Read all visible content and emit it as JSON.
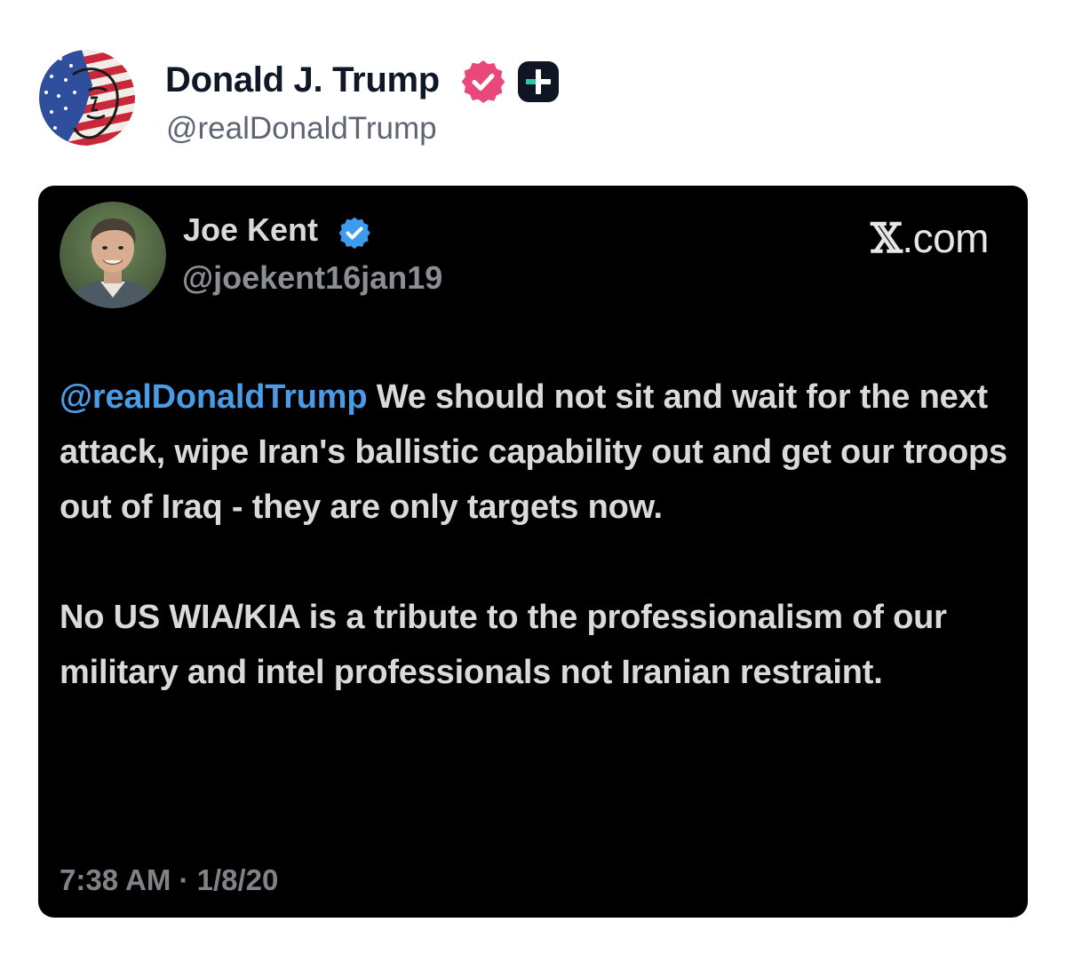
{
  "post": {
    "author_name": "Donald J. Trump",
    "author_handle": "@realDonaldTrump",
    "avatar_icon": "flag-portrait-avatar",
    "verified_icon": "verified-badge-icon",
    "plus_icon": "plus-badge-icon",
    "colors": {
      "name": "#101828",
      "handle": "#5f6673",
      "verified": "#e8497a",
      "plus_bg": "#0f1522",
      "plus_accent": "#29c7a3"
    }
  },
  "embed": {
    "author_name": "Joe Kent",
    "author_handle": "@joekent16jan19",
    "source_x": "𝕏",
    "source_domain": ".com",
    "mention": "@realDonaldTrump",
    "paragraph1_rest": " We should not sit and wait for the next attack, wipe Iran's ballistic capability out and get our troops out of Iraq - they are only targets now.",
    "paragraph2": "No US WIA/KIA is a tribute to the professionalism of our military and intel professionals not Iranian restraint.",
    "timestamp": "7:38 AM · 1/8/20",
    "avatar_icon": "person-portrait-avatar",
    "verified_icon": "blue-verified-check-icon",
    "colors": {
      "background": "#000000",
      "text": "#dadada",
      "mention": "#4a9be6",
      "verified": "#3d9bec",
      "muted": "#7f8388"
    }
  }
}
